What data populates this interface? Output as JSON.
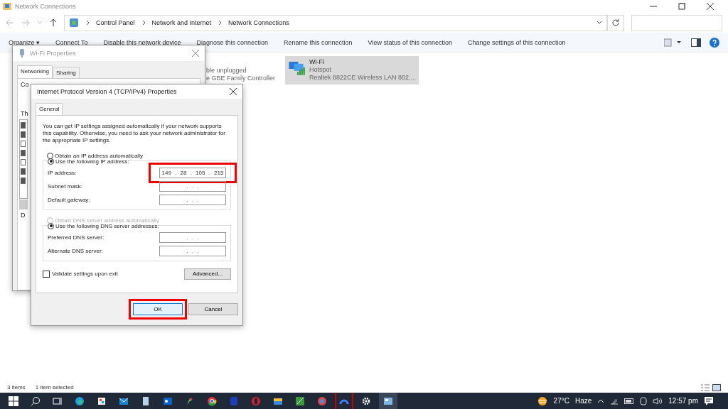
{
  "window": {
    "title": "Network Connections"
  },
  "breadcrumb": [
    "Control Panel",
    "Network and Internet",
    "Network Connections"
  ],
  "toolbar": [
    "Organize ▾",
    "Connect To",
    "Disable this network device",
    "Diagnose this connection",
    "Rename this connection",
    "View status of this connection",
    "Change settings of this connection"
  ],
  "connections": [
    {
      "lines": [
        "ble unplugged",
        "e GBE Family Controller"
      ],
      "selected": false
    },
    {
      "name": "Wi-Fi",
      "lines": [
        "Hotspot",
        "Realtek 8822CE Wireless LAN 802...."
      ],
      "selected": true
    }
  ],
  "wifi_dialog": {
    "title": "Wi-Fi Properties",
    "tabs": [
      {
        "label": "Networking",
        "selected": true
      },
      {
        "label": "Sharing",
        "selected": false
      }
    ],
    "fragments": [
      "Co",
      "Th",
      "D"
    ],
    "components": [
      {
        "checked": true
      },
      {
        "checked": true
      },
      {
        "checked": false
      },
      {
        "checked": true
      },
      {
        "checked": false
      },
      {
        "checked": true
      },
      {
        "checked": true
      }
    ]
  },
  "ipv4_dialog": {
    "title": "Internet Protocol Version 4 (TCP/IPv4) Properties",
    "tabs": [
      {
        "label": "General",
        "selected": true
      }
    ],
    "description": "You can get IP settings assigned automatically if your network supports this capability. Otherwise, you need to ask your network administrator for the appropriate IP settings.",
    "ip_options": [
      {
        "label": "Obtain an IP address automatically",
        "selected": false,
        "disabled": false
      },
      {
        "label": "Use the following IP address:",
        "selected": true,
        "disabled": false
      }
    ],
    "ip_fields": [
      {
        "label": "IP address:",
        "value": "149 . 28 . 105 . 215",
        "highlighted": true
      },
      {
        "label": "Subnet mask:",
        "value": ". . .",
        "highlighted": false
      },
      {
        "label": "Default gateway:",
        "value": ". . .",
        "highlighted": false
      }
    ],
    "dns_options": [
      {
        "label": "Obtain DNS server address automatically",
        "selected": false,
        "disabled": true
      },
      {
        "label": "Use the following DNS server addresses:",
        "selected": true,
        "disabled": false
      }
    ],
    "dns_fields": [
      {
        "label": "Preferred DNS server:",
        "value": ". . .",
        "highlighted": false
      },
      {
        "label": "Alternate DNS server:",
        "value": ". . .",
        "highlighted": false
      }
    ],
    "validate": {
      "label": "Validate settings upon exit",
      "checked": false
    },
    "advanced_button": "Advanced...",
    "buttons": [
      {
        "label": "OK",
        "highlighted": true
      },
      {
        "label": "Cancel",
        "highlighted": false
      }
    ]
  },
  "status_bar": [
    "3 items",
    "1 item selected"
  ],
  "taskbar": {
    "weather": "27°C",
    "condition": "Haze",
    "time": "12:57 pm"
  }
}
